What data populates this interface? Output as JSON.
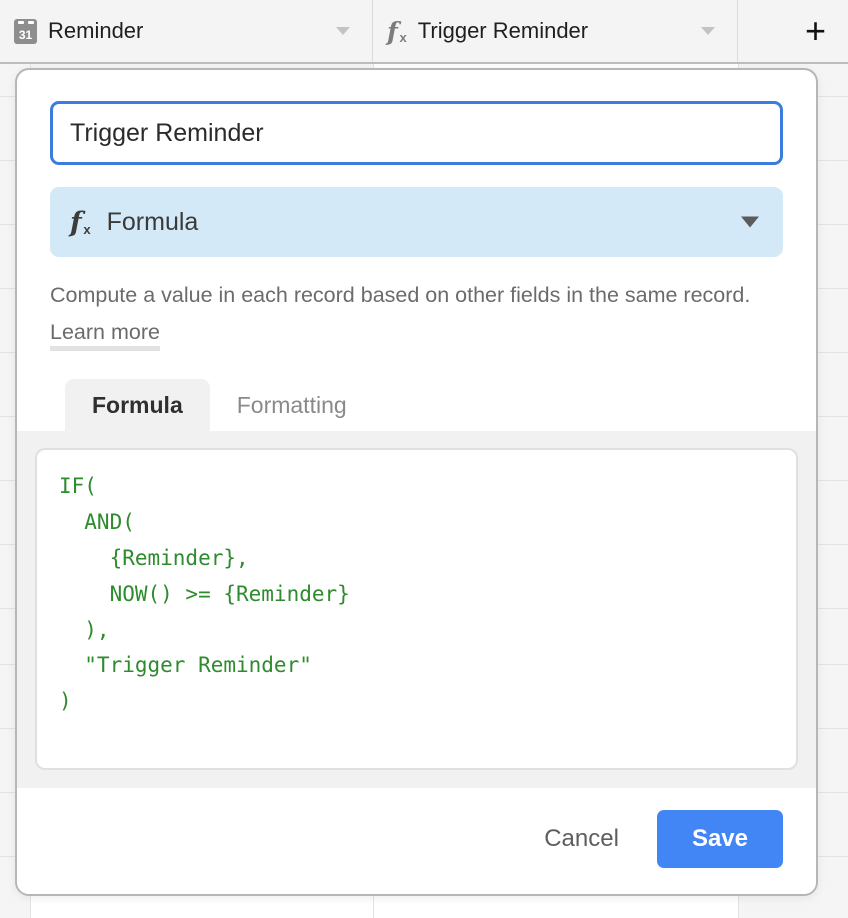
{
  "grid": {
    "columns": [
      {
        "icon": "calendar-icon",
        "icon_day": "31",
        "label": "Reminder",
        "has_caret": true
      },
      {
        "icon": "formula-fx-icon",
        "label": "Trigger Reminder",
        "has_caret": true
      }
    ],
    "add_field_label": "+"
  },
  "dialog": {
    "field_name": {
      "value": "Trigger Reminder",
      "placeholder": "Field name (optional)"
    },
    "field_type": {
      "icon": "formula-fx-icon",
      "label": "Formula"
    },
    "description": {
      "text": "Compute a value in each record based on other fields in the same record.",
      "link_label": "Learn more"
    },
    "tabs": [
      {
        "label": "Formula",
        "active": true
      },
      {
        "label": "Formatting",
        "active": false
      }
    ],
    "formula": {
      "value": "IF(\n  AND(\n    {Reminder},\n    NOW() >= {Reminder}\n  ),\n  \"Trigger Reminder\"\n)",
      "placeholder": "Enter a formula"
    },
    "footer": {
      "cancel_label": "Cancel",
      "save_label": "Save"
    }
  },
  "colors": {
    "accent_blue": "#4285f4",
    "focus_blue": "#3b7ddd",
    "type_chip_bg": "#d3e9f7",
    "formula_green": "#2e8b2e",
    "panel_gray": "#f1f1f1"
  }
}
